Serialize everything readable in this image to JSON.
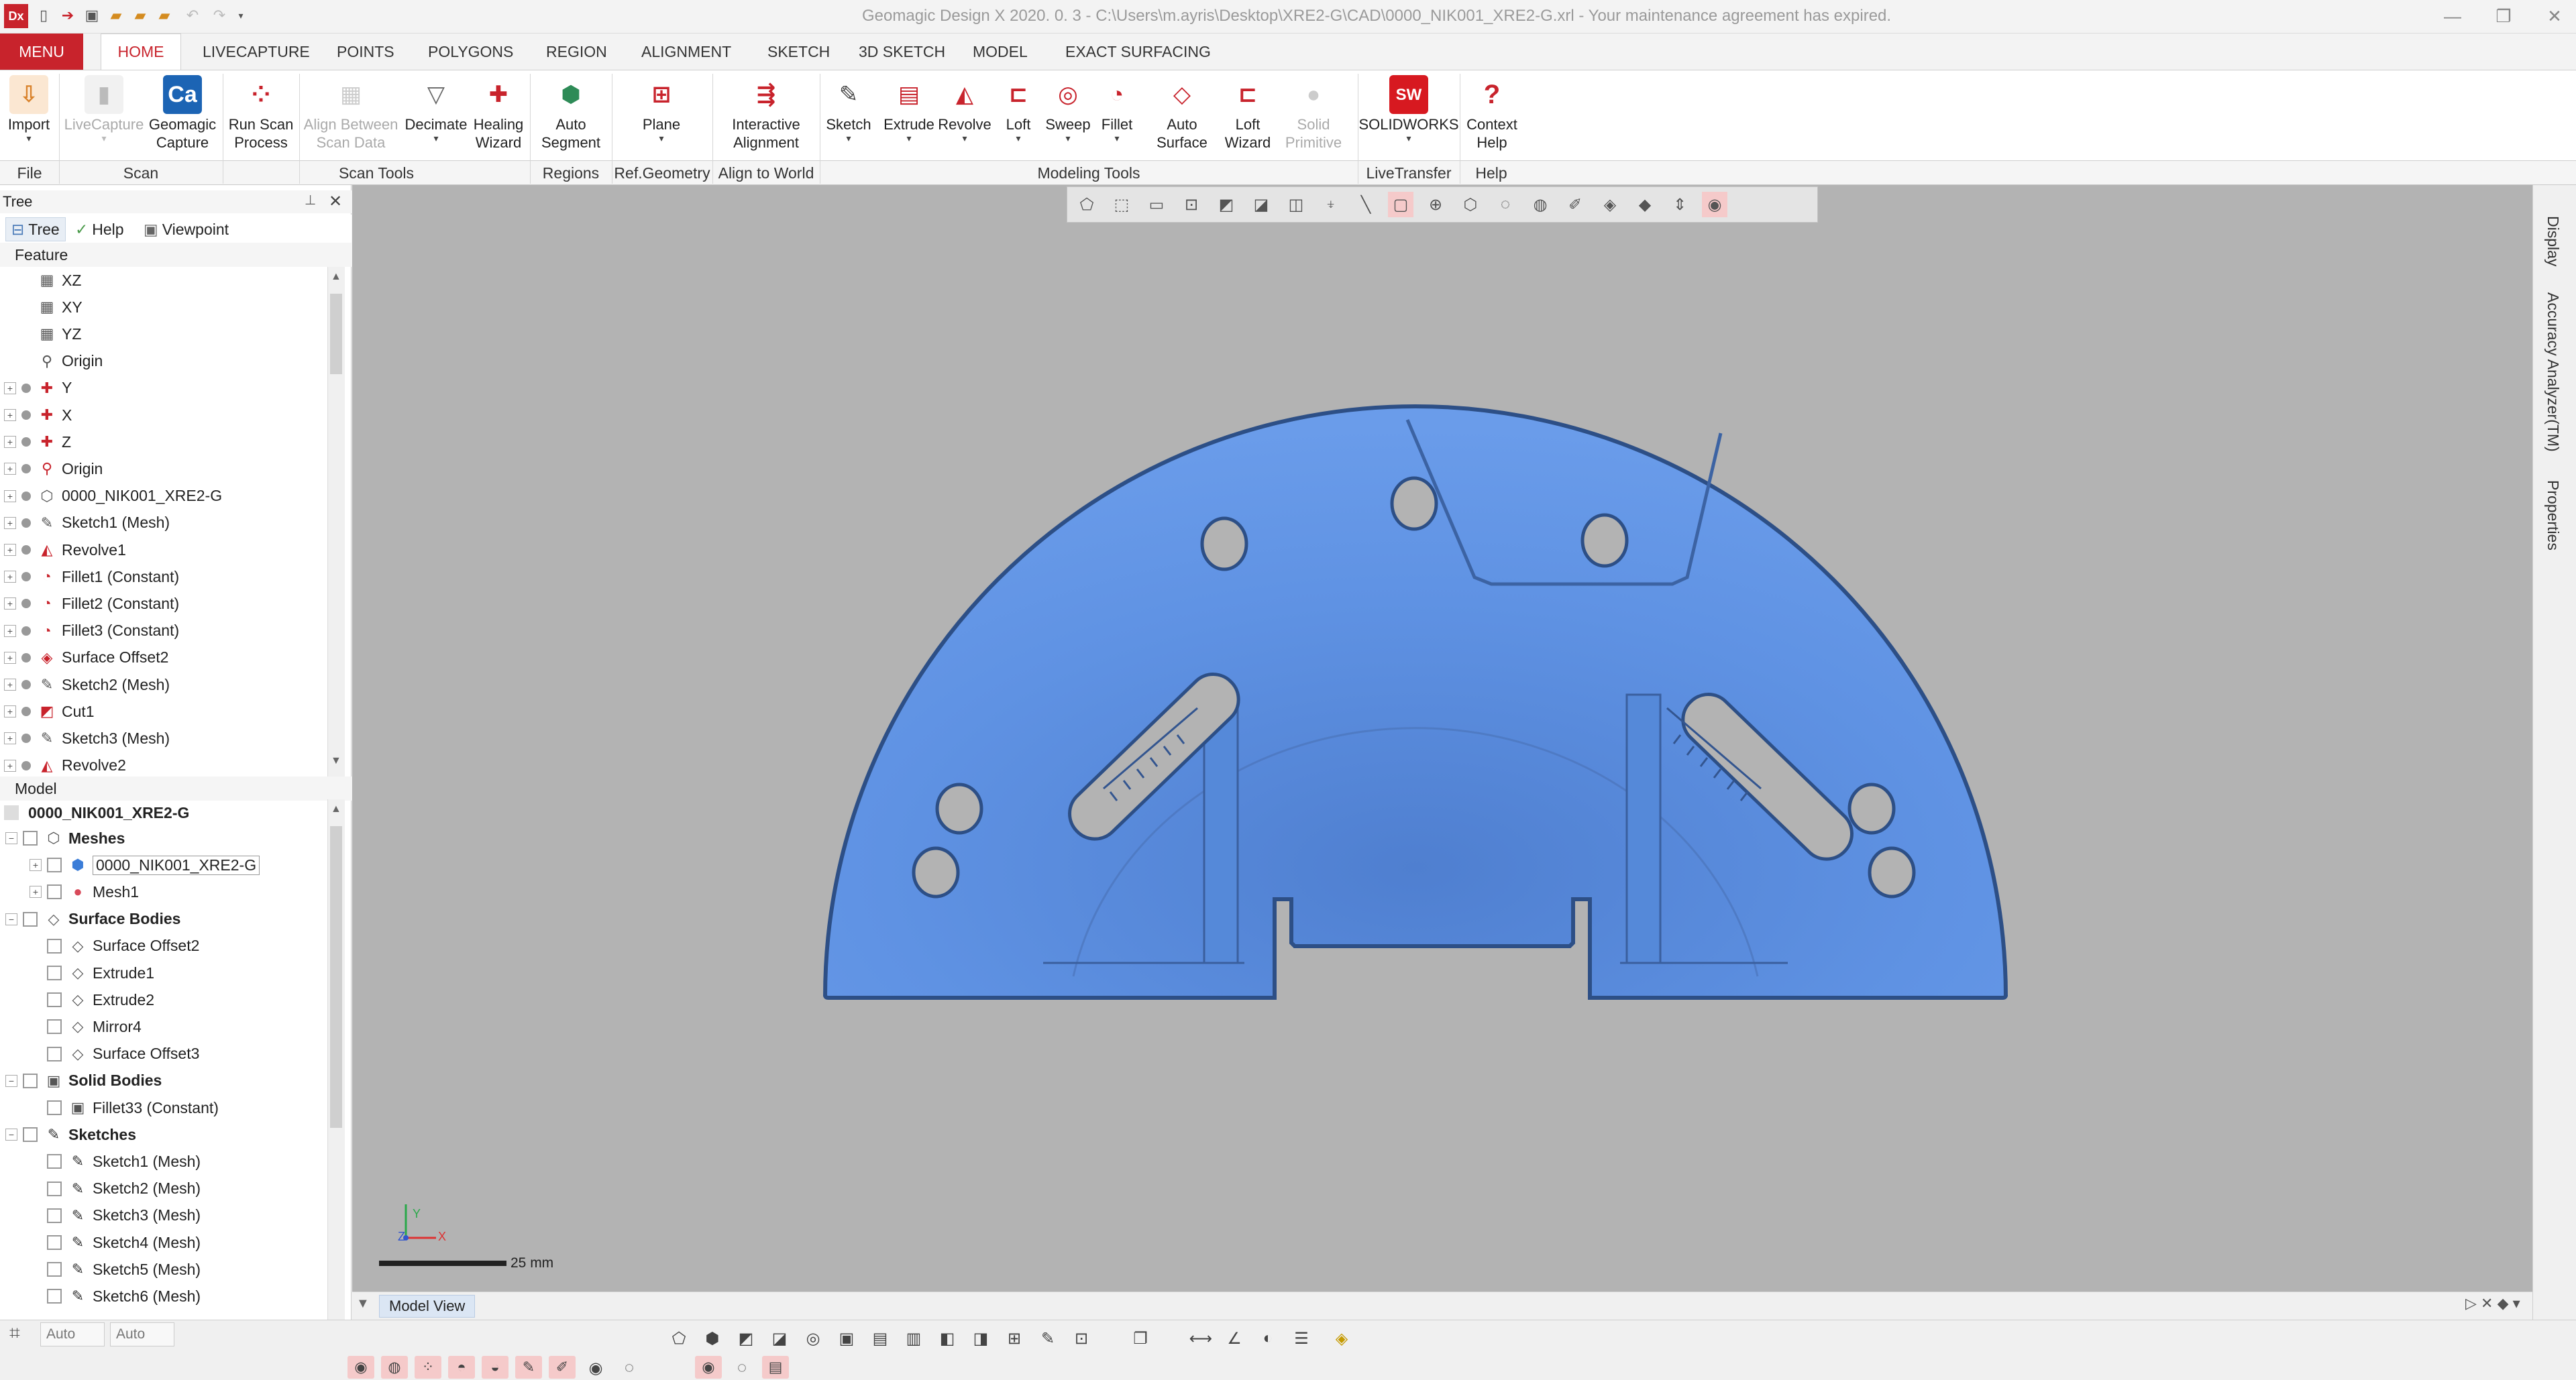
{
  "window": {
    "title": "Geomagic Design X 2020. 0. 3 - C:\\Users\\m.ayris\\Desktop\\XRE2-G\\CAD\\0000_NIK001_XRE2-G.xrl - Your maintenance agreement has expired.",
    "app_logo": "Dx"
  },
  "tabs": [
    "MENU",
    "HOME",
    "LIVECAPTURE",
    "POINTS",
    "POLYGONS",
    "REGION",
    "ALIGNMENT",
    "SKETCH",
    "3D SKETCH",
    "MODEL",
    "EXACT SURFACING"
  ],
  "ribbon": {
    "buttons": [
      {
        "label": "Import",
        "label2": "",
        "icon": "import-icon"
      },
      {
        "label": "LiveCapture",
        "label2": "",
        "icon": "livecapture-icon"
      },
      {
        "label": "Geomagic",
        "label2": "Capture",
        "icon": "capture-icon"
      },
      {
        "label": "Run Scan",
        "label2": "Process",
        "icon": "scan-process-icon"
      },
      {
        "label": "Align Between",
        "label2": "Scan Data",
        "icon": "align-scan-icon"
      },
      {
        "label": "Decimate",
        "label2": "",
        "icon": "decimate-icon"
      },
      {
        "label": "Healing",
        "label2": "Wizard",
        "icon": "healing-icon"
      },
      {
        "label": "Auto",
        "label2": "Segment",
        "icon": "auto-segment-icon"
      },
      {
        "label": "Plane",
        "label2": "",
        "icon": "plane-icon"
      },
      {
        "label": "Interactive",
        "label2": "Alignment",
        "icon": "interactive-alignment-icon"
      },
      {
        "label": "Sketch",
        "label2": "",
        "icon": "sketch-icon"
      },
      {
        "label": "Extrude",
        "label2": "",
        "icon": "extrude-icon"
      },
      {
        "label": "Revolve",
        "label2": "",
        "icon": "revolve-icon"
      },
      {
        "label": "Loft",
        "label2": "",
        "icon": "loft-icon"
      },
      {
        "label": "Sweep",
        "label2": "",
        "icon": "sweep-icon"
      },
      {
        "label": "Fillet",
        "label2": "",
        "icon": "fillet-icon"
      },
      {
        "label": "Auto",
        "label2": "Surface",
        "icon": "auto-surface-icon"
      },
      {
        "label": "Loft",
        "label2": "Wizard",
        "icon": "loft-wizard-icon"
      },
      {
        "label": "Solid",
        "label2": "Primitive",
        "icon": "solid-primitive-icon"
      },
      {
        "label": "SOLIDWORKS",
        "label2": "",
        "icon": "solidworks-icon"
      },
      {
        "label": "Context",
        "label2": "Help",
        "icon": "context-help-icon"
      }
    ],
    "groups": [
      "File",
      "Scan",
      "Scan Tools",
      "Regions",
      "Ref.Geometry",
      "Align to World",
      "Modeling Tools",
      "LiveTransfer",
      "Help"
    ]
  },
  "left_panel": {
    "header": "Tree",
    "tabs": [
      "Tree",
      "Help",
      "Viewpoint"
    ],
    "feature_label": "Feature",
    "feature_items": [
      "XZ",
      "XY",
      "YZ",
      "Origin",
      "Y",
      "X",
      "Z",
      "Origin",
      "0000_NIK001_XRE2-G",
      "Sketch1 (Mesh)",
      "Revolve1",
      "Fillet1 (Constant)",
      "Fillet2 (Constant)",
      "Fillet3 (Constant)",
      "Surface Offset2",
      "Sketch2 (Mesh)",
      "Cut1",
      "Sketch3 (Mesh)",
      "Revolve2"
    ],
    "model_label": "Model",
    "model_root": "0000_NIK001_XRE2-G",
    "model_items": [
      {
        "label": "Meshes",
        "bold": true,
        "level": 0
      },
      {
        "label": "0000_NIK001_XRE2-G",
        "bold": false,
        "level": 1
      },
      {
        "label": "Mesh1",
        "bold": false,
        "level": 1
      },
      {
        "label": "Surface Bodies",
        "bold": true,
        "level": 0
      },
      {
        "label": "Surface Offset2",
        "bold": false,
        "level": 1
      },
      {
        "label": "Extrude1",
        "bold": false,
        "level": 1
      },
      {
        "label": "Extrude2",
        "bold": false,
        "level": 1
      },
      {
        "label": "Mirror4",
        "bold": false,
        "level": 1
      },
      {
        "label": "Surface Offset3",
        "bold": false,
        "level": 1
      },
      {
        "label": "Solid Bodies",
        "bold": true,
        "level": 0
      },
      {
        "label": "Fillet33 (Constant)",
        "bold": false,
        "level": 1
      },
      {
        "label": "Sketches",
        "bold": true,
        "level": 0
      },
      {
        "label": "Sketch1 (Mesh)",
        "bold": false,
        "level": 1
      },
      {
        "label": "Sketch2 (Mesh)",
        "bold": false,
        "level": 1
      },
      {
        "label": "Sketch3 (Mesh)",
        "bold": false,
        "level": 1
      },
      {
        "label": "Sketch4 (Mesh)",
        "bold": false,
        "level": 1
      },
      {
        "label": "Sketch5 (Mesh)",
        "bold": false,
        "level": 1
      },
      {
        "label": "Sketch6 (Mesh)",
        "bold": false,
        "level": 1
      }
    ]
  },
  "viewport": {
    "scale_label": "25 mm",
    "bg_color": "#b3b3b3",
    "mesh_color": "#5b8edc"
  },
  "right_panels": [
    "Display",
    "Accuracy Analyzer(TM)",
    "Properties"
  ],
  "bottom": {
    "view_tab": "Model View",
    "status_fields": [
      "Auto",
      "Auto"
    ]
  }
}
